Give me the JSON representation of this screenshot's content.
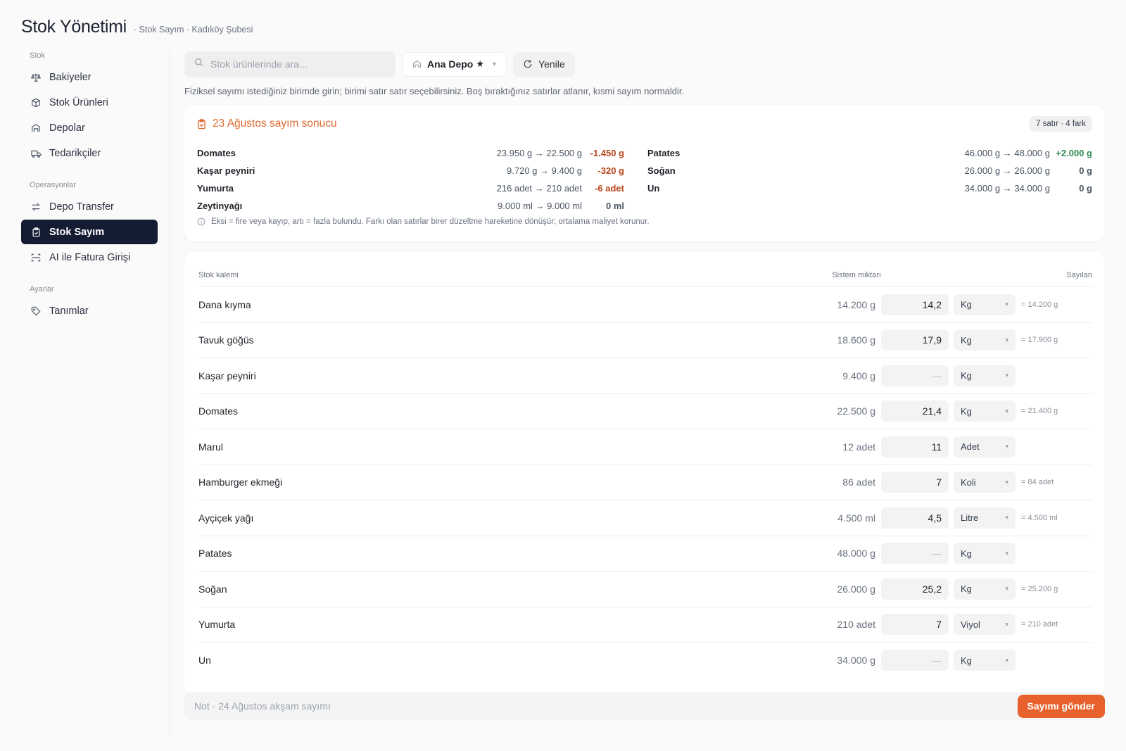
{
  "header": {
    "title": "Stok Yönetimi",
    "subtitle": "· Stok Sayım · Kadıköy Şubesi"
  },
  "sidebar": {
    "sections": [
      {
        "label": "Stok",
        "items": [
          {
            "label": "Bakiyeler",
            "icon": "scale-icon"
          },
          {
            "label": "Stok Ürünleri",
            "icon": "box-icon"
          },
          {
            "label": "Depolar",
            "icon": "warehouse-icon"
          },
          {
            "label": "Tedarikçiler",
            "icon": "truck-icon"
          }
        ]
      },
      {
        "label": "Operasyonlar",
        "items": [
          {
            "label": "Depo Transfer",
            "icon": "transfer-icon"
          },
          {
            "label": "Stok Sayım",
            "icon": "clipboard-icon",
            "active": true
          },
          {
            "label": "AI ile Fatura Girişi",
            "icon": "scan-icon"
          }
        ]
      },
      {
        "label": "Ayarlar",
        "items": [
          {
            "label": "Tanımlar",
            "icon": "tag-icon"
          }
        ]
      }
    ]
  },
  "toolbar": {
    "search_placeholder": "Stok ürünlerinde ara...",
    "depot_label": "Ana Depo",
    "refresh_label": "Yenile"
  },
  "hint": "Fiziksel sayımı istediğiniz birimde girin; birimi satır satır seçebilirsiniz. Boş bıraktığınız satırlar atlanır, kısmi sayım normaldir.",
  "result": {
    "title": "23 Ağustos sayım sonucu",
    "badge": "7 satır · 4 fark",
    "left": [
      {
        "name": "Domates",
        "change": "23.950 g → 22.500 g",
        "diff": "-1.450 g",
        "kind": "neg"
      },
      {
        "name": "Kaşar peyniri",
        "change": "9.720 g → 9.400 g",
        "diff": "-320 g",
        "kind": "neg"
      },
      {
        "name": "Yumurta",
        "change": "216 adet → 210 adet",
        "diff": "-6 adet",
        "kind": "neg"
      },
      {
        "name": "Zeytinyağı",
        "change": "9.000 ml → 9.000 ml",
        "diff": "0 ml",
        "kind": "zero"
      }
    ],
    "right": [
      {
        "name": "Patates",
        "change": "46.000 g → 48.000 g",
        "diff": "+2.000 g",
        "kind": "pos"
      },
      {
        "name": "Soğan",
        "change": "26.000 g → 26.000 g",
        "diff": "0 g",
        "kind": "zero"
      },
      {
        "name": "Un",
        "change": "34.000 g → 34.000 g",
        "diff": "0 g",
        "kind": "zero"
      }
    ],
    "note": "Eksi = fire veya kayıp, artı = fazla bulundu. Farkı olan satırlar birer düzeltme hareketine dönüşür; ortalama maliyet korunur.",
    "colors": {
      "negative": "#b7451a",
      "positive": "#2f8a4f",
      "accent": "#e0692e"
    }
  },
  "table": {
    "headers": {
      "item": "Stok kalemi",
      "system": "Sistem miktarı",
      "counted": "Sayılan"
    },
    "rows": [
      {
        "name": "Dana kıyma",
        "system": "14.200 g",
        "qty": "14,2",
        "unit": "Kg",
        "conv": "= 14.200 g"
      },
      {
        "name": "Tavuk göğüs",
        "system": "18.600 g",
        "qty": "17,9",
        "unit": "Kg",
        "conv": "= 17.900 g"
      },
      {
        "name": "Kaşar peyniri",
        "system": "9.400 g",
        "qty": "—",
        "unit": "Kg",
        "conv": ""
      },
      {
        "name": "Domates",
        "system": "22.500 g",
        "qty": "21,4",
        "unit": "Kg",
        "conv": "= 21.400 g"
      },
      {
        "name": "Marul",
        "system": "12 adet",
        "qty": "11",
        "unit": "Adet",
        "conv": ""
      },
      {
        "name": "Hamburger ekmeği",
        "system": "86 adet",
        "qty": "7",
        "unit": "Koli",
        "conv": "= 84 adet"
      },
      {
        "name": "Ayçiçek yağı",
        "system": "4.500 ml",
        "qty": "4,5",
        "unit": "Litre",
        "conv": "= 4.500 ml"
      },
      {
        "name": "Patates",
        "system": "48.000 g",
        "qty": "—",
        "unit": "Kg",
        "conv": ""
      },
      {
        "name": "Soğan",
        "system": "26.000 g",
        "qty": "25,2",
        "unit": "Kg",
        "conv": "= 25.200 g"
      },
      {
        "name": "Yumurta",
        "system": "210 adet",
        "qty": "7",
        "unit": "Viyol",
        "conv": "= 210 adet"
      },
      {
        "name": "Un",
        "system": "34.000 g",
        "qty": "—",
        "unit": "Kg",
        "conv": ""
      }
    ]
  },
  "footer": {
    "note_placeholder": "Not · 24 Ağustos akşam sayımı",
    "submit_label": "Sayımı gönder",
    "submit_color": "#e8612c"
  }
}
